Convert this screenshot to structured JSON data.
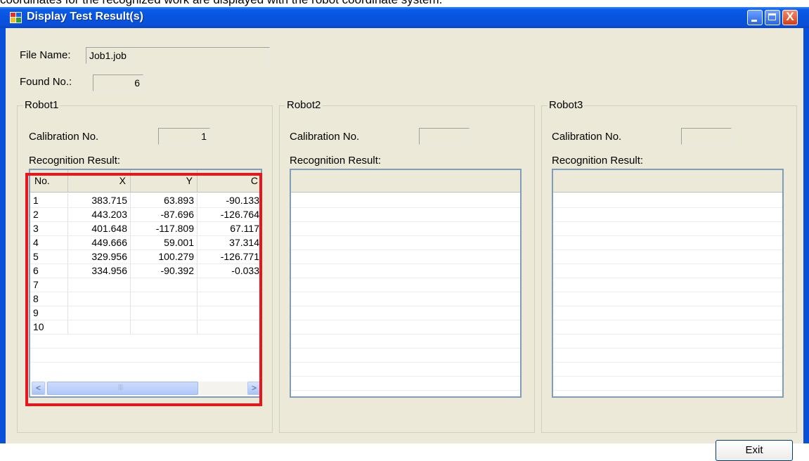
{
  "caption": "coordinates for the recognized work are displayed with the robot coordinate system.",
  "window": {
    "title": "Display Test Result(s)",
    "close_glyph": "X"
  },
  "file": {
    "label": "File Name:",
    "value": "Job1.job"
  },
  "found": {
    "label": "Found No.:",
    "value": "6"
  },
  "robots": [
    {
      "title": "Robot1",
      "calibration_label": "Calibration No.",
      "calibration_value": "1",
      "recognition_label": "Recognition Result:",
      "columns": [
        "No.",
        "X",
        "Y",
        "C"
      ],
      "rows": [
        [
          "1",
          "383.715",
          "63.893",
          "-90.133"
        ],
        [
          "2",
          "443.203",
          "-87.696",
          "-126.764"
        ],
        [
          "3",
          "401.648",
          "-117.809",
          "67.117"
        ],
        [
          "4",
          "449.666",
          "59.001",
          "37.314"
        ],
        [
          "5",
          "329.956",
          "100.279",
          "-126.771"
        ],
        [
          "6",
          "334.956",
          "-90.392",
          "-0.033"
        ],
        [
          "7",
          "",
          "",
          ""
        ],
        [
          "8",
          "",
          "",
          ""
        ],
        [
          "9",
          "",
          "",
          ""
        ],
        [
          "10",
          "",
          "",
          ""
        ]
      ]
    },
    {
      "title": "Robot2",
      "calibration_label": "Calibration No.",
      "calibration_value": "",
      "recognition_label": "Recognition Result:"
    },
    {
      "title": "Robot3",
      "calibration_label": "Calibration No.",
      "calibration_value": "",
      "recognition_label": "Recognition Result:"
    }
  ],
  "scrollbar": {
    "left_arrow": "<",
    "right_arrow": ">"
  },
  "exit_button": {
    "label": "Exit"
  },
  "colors": {
    "highlight": "#e8161c",
    "titlebar": "#0a4fd8",
    "client": "#ece9d8"
  },
  "icons": [
    "app-icon",
    "minimize-icon",
    "maximize-icon",
    "close-icon",
    "scroll-left-icon",
    "scroll-right-icon"
  ]
}
